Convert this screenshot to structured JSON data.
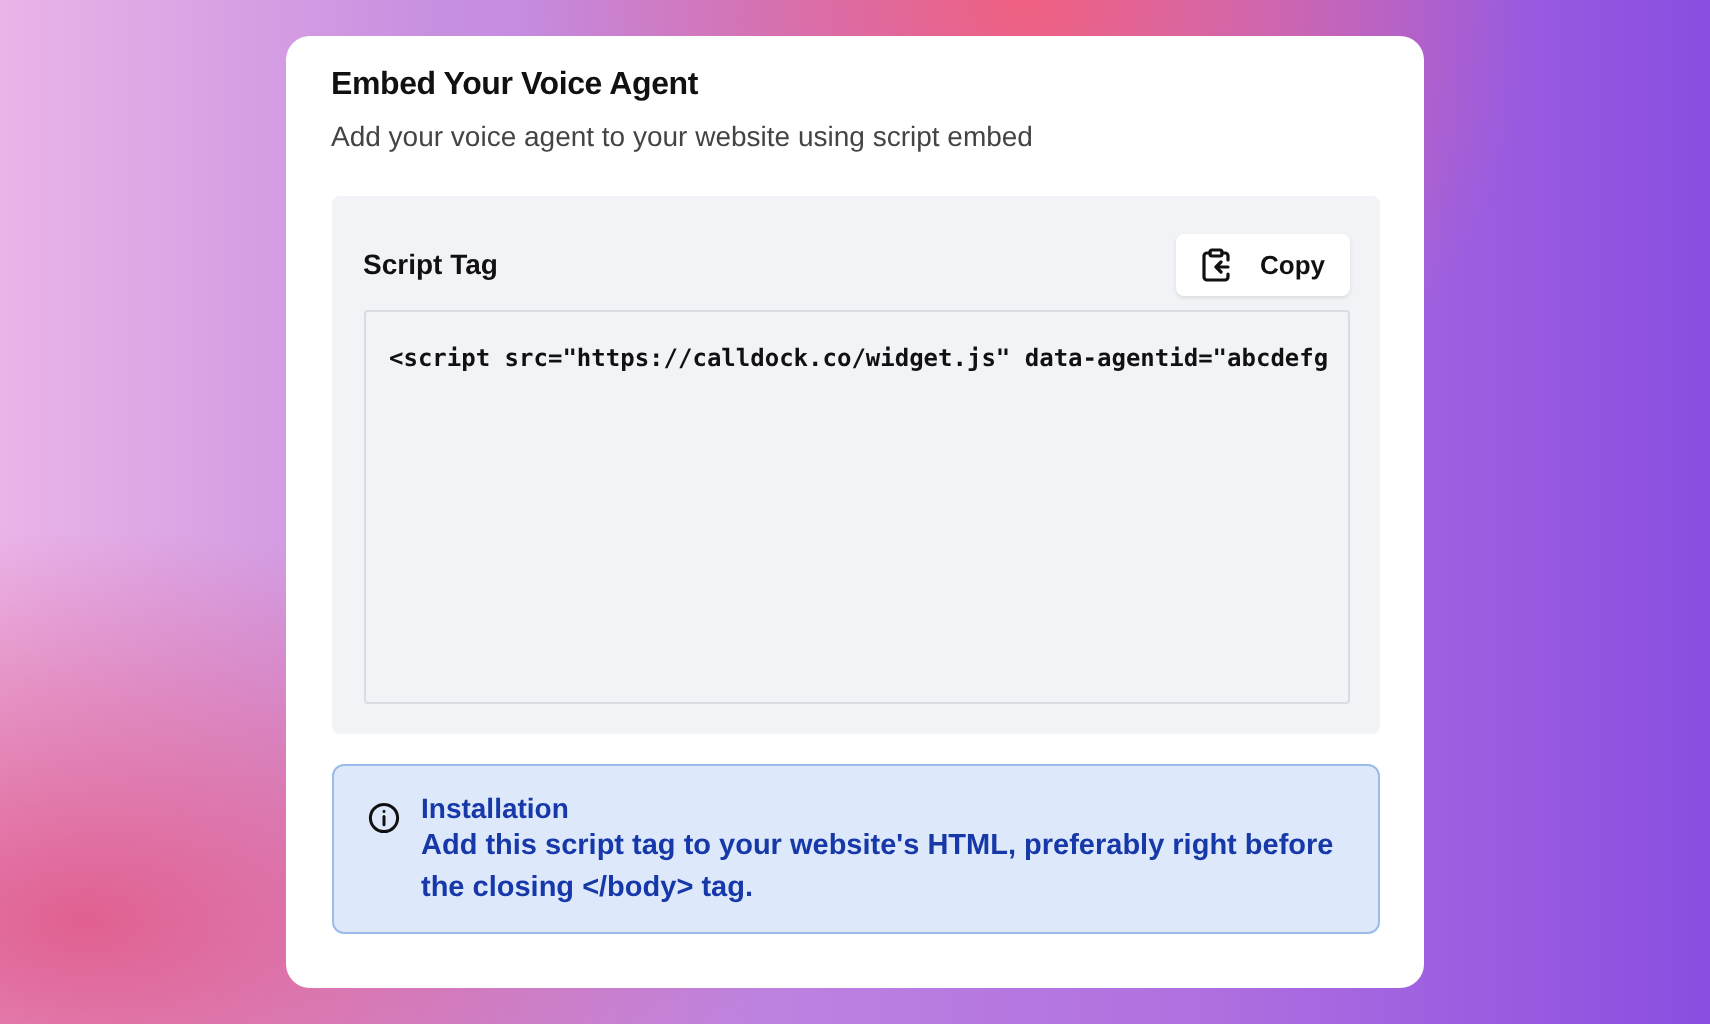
{
  "card": {
    "title": "Embed Your Voice Agent",
    "subtitle": "Add your voice agent to your website using script embed"
  },
  "script_panel": {
    "label": "Script Tag",
    "copy_button": "Copy",
    "code": "<script src=\"https://calldock.co/widget.js\" data-agentid=\"abcdefg"
  },
  "info": {
    "title": "Installation",
    "text": "Add this script tag to your website's HTML, preferably right before the closing </body> tag."
  }
}
